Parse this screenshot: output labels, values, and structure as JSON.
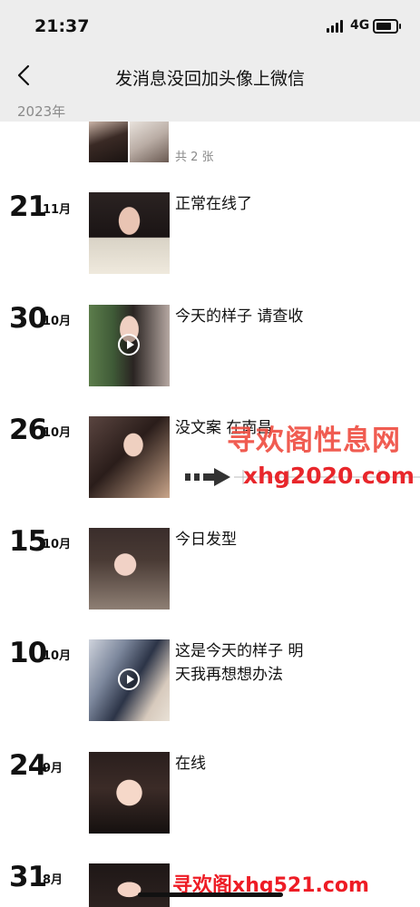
{
  "status_bar": {
    "time": "21:37",
    "network": "4G"
  },
  "navbar": {
    "title": "发消息没回加头像上微信",
    "back_icon": "chevron-left-icon"
  },
  "year_header": "2023年",
  "first_post": {
    "count_label": "共 2 张"
  },
  "posts": [
    {
      "day": "21",
      "month": "11月",
      "caption": "正常在线了",
      "has_video": false
    },
    {
      "day": "30",
      "month": "10月",
      "caption": "今天的样子 请查收",
      "has_video": true
    },
    {
      "day": "26",
      "month": "10月",
      "caption": "没文案 在南昌",
      "has_video": false
    },
    {
      "day": "15",
      "month": "10月",
      "caption": "今日发型",
      "has_video": false
    },
    {
      "day": "10",
      "month": "10月",
      "caption_line1": "这是今天的样子 明",
      "caption_line2": "天我再想想办法",
      "has_video": true
    },
    {
      "day": "24",
      "month": "9月",
      "caption": "在线",
      "has_video": false
    },
    {
      "day": "31",
      "month": "8月",
      "caption": "",
      "has_video": false
    }
  ],
  "watermarks": {
    "site_name": "寻欢阁性息网",
    "site_url": "xhg2020.com",
    "footer": "寻欢阁xhg521.com"
  },
  "colors": {
    "bar_bg": "#ededed",
    "watermark_red": "#e8262b",
    "muted": "#8a8a8a"
  }
}
